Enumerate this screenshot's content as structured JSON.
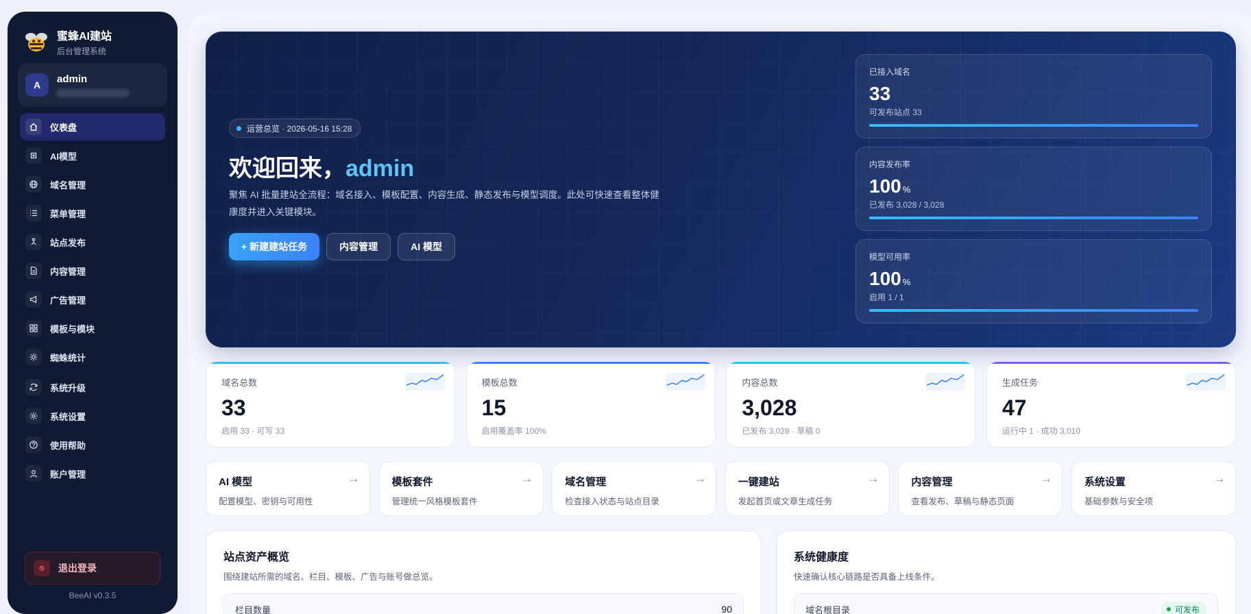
{
  "brand": {
    "title": "蜜蜂AI建站",
    "subtitle": "后台管理系统",
    "logo_icon": "bee-icon"
  },
  "user": {
    "avatar_letter": "A",
    "name": "admin"
  },
  "nav": {
    "items": [
      {
        "label": "仪表盘",
        "icon": "home-icon",
        "active": true
      },
      {
        "label": "AI模型",
        "icon": "cpu-icon"
      },
      {
        "label": "域名管理",
        "icon": "globe-icon"
      },
      {
        "label": "菜单管理",
        "icon": "list-icon"
      },
      {
        "label": "站点发布",
        "icon": "publish-icon"
      },
      {
        "label": "内容管理",
        "icon": "document-icon"
      },
      {
        "label": "广告管理",
        "icon": "megaphone-icon"
      },
      {
        "label": "模板与模块",
        "icon": "grid-icon"
      },
      {
        "label": "蜘蛛统计",
        "icon": "spider-icon"
      },
      {
        "label": "系统升级",
        "icon": "refresh-icon"
      },
      {
        "label": "系统设置",
        "icon": "gear-icon"
      },
      {
        "label": "使用帮助",
        "icon": "help-icon"
      },
      {
        "label": "账户管理",
        "icon": "user-icon"
      }
    ]
  },
  "logout": {
    "label": "退出登录"
  },
  "version": "BeeAI v0.3.5",
  "hero": {
    "pill": "运营总览 · 2026-05-16 15:28",
    "title_prefix": "欢迎回来，",
    "title_name": "admin",
    "description": "聚焦 AI 批量建站全流程：域名接入、模板配置、内容生成、静态发布与模型调度。此处可快速查看整体健康度并进入关键模块。",
    "buttons": {
      "primary": "+ 新建建站任务",
      "content": "内容管理",
      "model": "AI 模型"
    },
    "stats": [
      {
        "label": "已接入域名",
        "value": "33",
        "unit": "",
        "sub": "可发布站点 33",
        "progress": 1.0
      },
      {
        "label": "内容发布率",
        "value": "100",
        "unit": "%",
        "sub": "已发布 3,028 / 3,028",
        "progress": 1.0
      },
      {
        "label": "模型可用率",
        "value": "100",
        "unit": "%",
        "sub": "启用 1 / 1",
        "progress": 1.0
      }
    ]
  },
  "cards": [
    {
      "label": "域名总数",
      "value": "33",
      "sub": "启用 33 · 可写 33",
      "accent": "#38bdf8"
    },
    {
      "label": "模板总数",
      "value": "15",
      "sub": "启用覆盖率 100%",
      "accent": "#3b82f6"
    },
    {
      "label": "内容总数",
      "value": "3,028",
      "sub": "已发布 3,028 · 草稿 0",
      "accent": "#22c3e6"
    },
    {
      "label": "生成任务",
      "value": "47",
      "sub": "运行中 1 · 成功 3,010",
      "accent": "#7c5cf5"
    }
  ],
  "links": [
    {
      "title": "AI 模型",
      "desc": "配置模型、密钥与可用性"
    },
    {
      "title": "模板套件",
      "desc": "管理统一风格模板套件"
    },
    {
      "title": "域名管理",
      "desc": "检查接入状态与站点目录"
    },
    {
      "title": "一键建站",
      "desc": "发起首页或文章生成任务"
    },
    {
      "title": "内容管理",
      "desc": "查看发布、草稿与静态页面"
    },
    {
      "title": "系统设置",
      "desc": "基础参数与安全项"
    }
  ],
  "link_arrow": "→",
  "assets_panel": {
    "title": "站点资产概览",
    "desc": "围绕建站所需的域名、栏目、模板、广告与账号做总览。",
    "row_label": "栏目数量",
    "row_value": "90"
  },
  "health_panel": {
    "title": "系统健康度",
    "desc": "快速确认核心链路是否具备上线条件。",
    "row_label": "域名根目录",
    "row_badge": "可发布"
  },
  "colors": {
    "accent": "#38bdf8",
    "sidebar": "#0f1a33",
    "hero": "#14285a",
    "success": "#16a34a"
  }
}
